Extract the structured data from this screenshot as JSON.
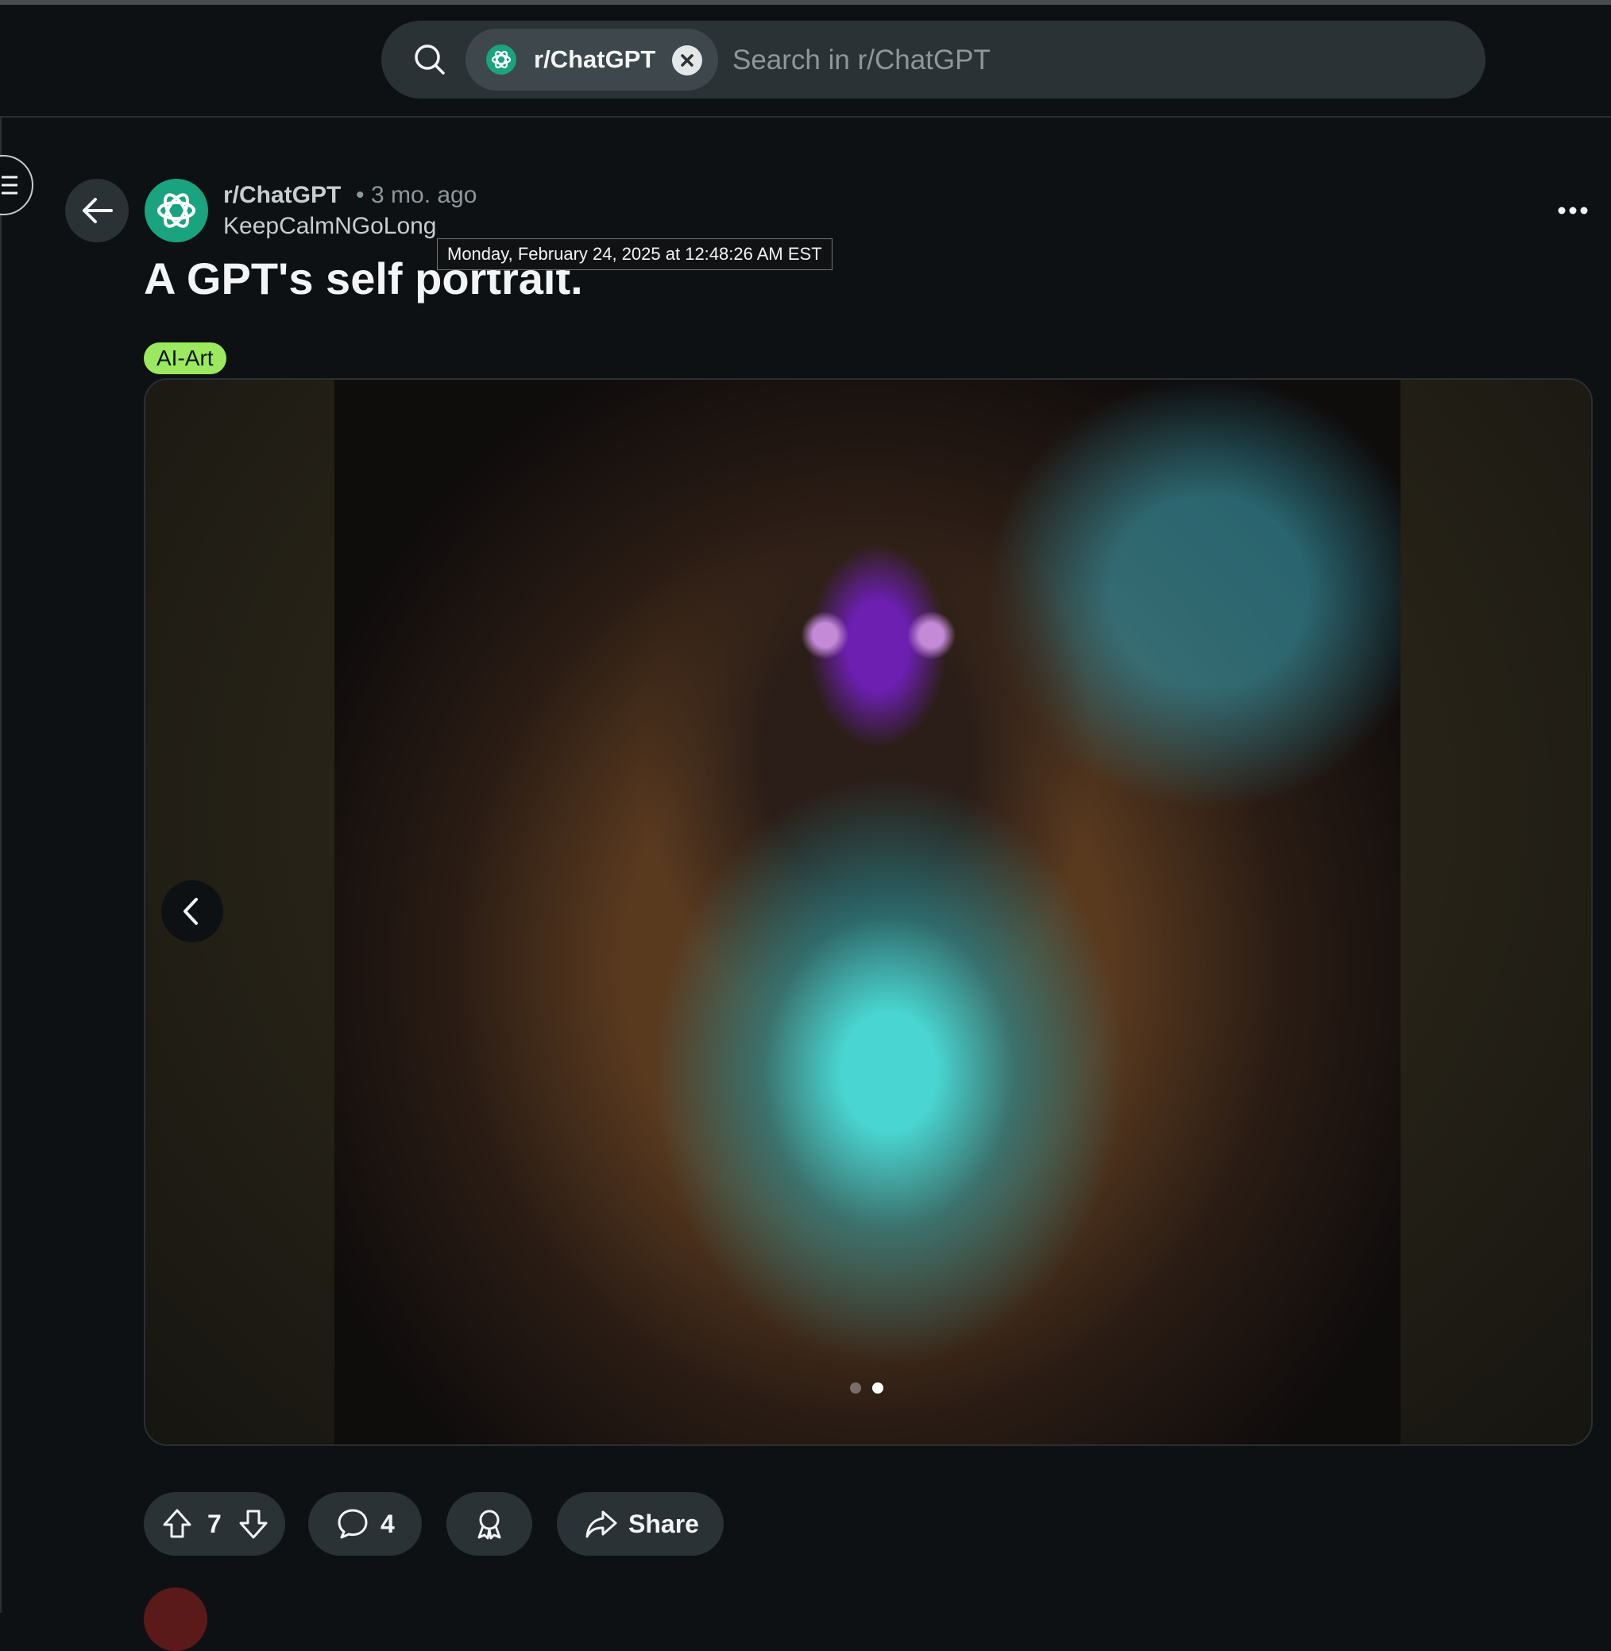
{
  "search": {
    "community_chip": "r/ChatGPT",
    "placeholder": "Search in r/ChatGPT"
  },
  "post": {
    "subreddit": "r/ChatGPT",
    "separator": "•",
    "time_ago": "3 mo. ago",
    "author": "KeepCalmNGoLong",
    "timestamp_tooltip": "Monday, February 24, 2025 at 12:48:26 AM EST",
    "title": "A GPT's self portrait.",
    "flair": "AI-Art",
    "flair_color": "#9ae95e",
    "gallery": {
      "image_count": 2,
      "current_image": 2
    }
  },
  "actions": {
    "upvotes": "7",
    "comments": "4",
    "share_label": "Share"
  },
  "colors": {
    "background": "#0e1113",
    "button_bg": "#2a3236",
    "subreddit_icon": "#19a37f"
  },
  "icons": [
    "search-icon",
    "openai-logo-icon",
    "close-icon",
    "menu-icon",
    "back-arrow-icon",
    "more-options-icon",
    "chevron-left-icon",
    "upvote-icon",
    "downvote-icon",
    "comment-icon",
    "award-icon",
    "share-icon"
  ]
}
